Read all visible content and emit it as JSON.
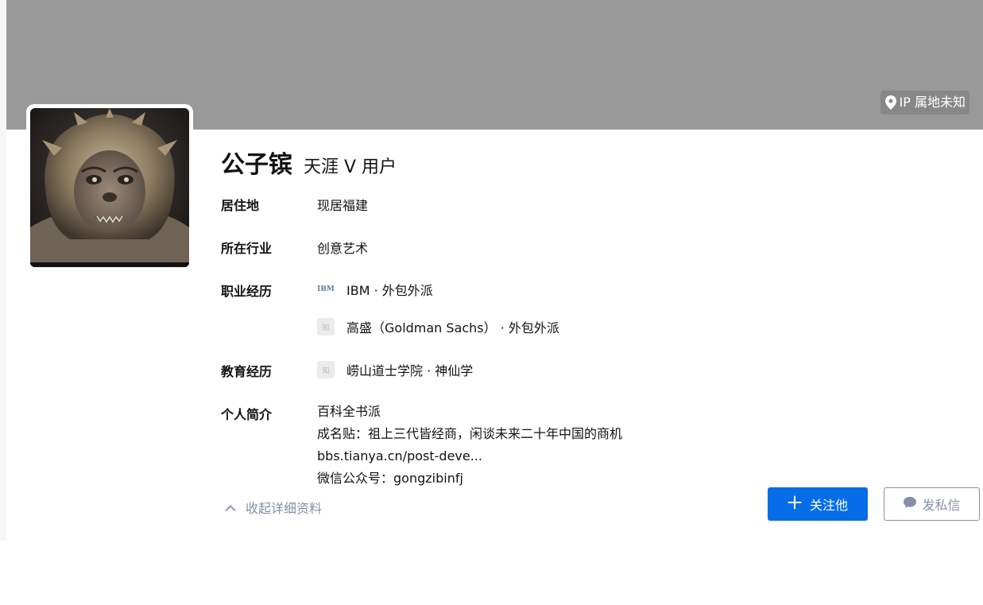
{
  "cover": {
    "ip_location": "IP 属地未知"
  },
  "profile": {
    "name": "公子镔",
    "headline": "天涯 V 用户"
  },
  "details": {
    "residence": {
      "label": "居住地",
      "value": "现居福建"
    },
    "industry": {
      "label": "所在行业",
      "value": "创意艺术"
    },
    "career": {
      "label": "职业经历",
      "items": [
        {
          "logo": "IBM",
          "text": "IBM · 外包外派"
        },
        {
          "logo": "知",
          "text": "高盛（Goldman Sachs） · 外包外派"
        }
      ]
    },
    "education": {
      "label": "教育经历",
      "items": [
        {
          "logo": "知",
          "text": "崂山道士学院 · 神仙学"
        }
      ]
    },
    "bio": {
      "label": "个人简介",
      "lines": [
        "百科全书派",
        "成名贴：祖上三代皆经商，闲谈未来二十年中国的商机",
        "bbs.tianya.cn/post-deve...",
        "微信公众号：gongzibinfj"
      ]
    }
  },
  "actions": {
    "collapse_label": "收起详细资料",
    "follow_label": "关注他",
    "message_label": "发私信"
  },
  "colors": {
    "cover": "#999999",
    "primary": "#056de8",
    "muted": "#8590a6",
    "text": "#121212"
  },
  "icons": {
    "location": "location-pin-icon",
    "collapse": "chevron-up-icon",
    "follow": "plus-icon",
    "message": "chat-bubble-icon"
  }
}
